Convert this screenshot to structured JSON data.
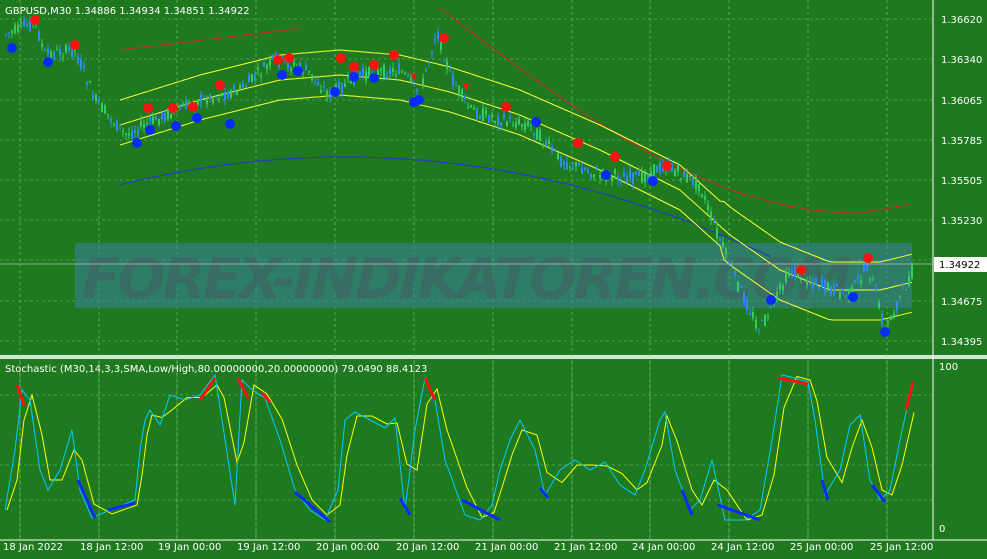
{
  "main_chart": {
    "header": "GBPUSD,M30  1.34886 1.34934 1.34851 1.34922",
    "symbol": "GBPUSD",
    "timeframe": "M30",
    "ohlc": [
      "1.34886",
      "1.34934",
      "1.34851",
      "1.34922"
    ],
    "current_price": "1.34922",
    "price_ticks": [
      "1.36620",
      "1.36340",
      "1.36065",
      "1.35785",
      "1.35505",
      "1.35230",
      "1.34675",
      "1.34395"
    ],
    "watermark": "FOREX-INDIKATOREN.COM"
  },
  "stochastic": {
    "header": "Stochastic (M30,14,3,3,SMA,Low/High,80.00000000,20.00000000) 79.0490 88.4123",
    "levels": [
      "100",
      "0"
    ],
    "main_value": "79.0490",
    "signal_value": "88.4123"
  },
  "time_axis": [
    "18 Jan 2022",
    "18 Jan 12:00",
    "19 Jan 00:00",
    "19 Jan 12:00",
    "20 Jan 00:00",
    "20 Jan 12:00",
    "21 Jan 00:00",
    "21 Jan 12:00",
    "24 Jan 00:00",
    "24 Jan 12:00",
    "25 Jan 00:00",
    "25 Jan 12:00"
  ],
  "colors": {
    "background": "#1f7a1f",
    "grid": "#7fc07f",
    "bull_candle": "#33cc66",
    "bear_candle": "#2e8bff",
    "channel": "#ffff33",
    "upper_curve": "#b8322a",
    "lower_curve": "#1f3fbf",
    "sell_dot": "#ff1111",
    "buy_dot": "#0a2bff",
    "stoch_main": "#00ccff",
    "stoch_signal": "#ffff00"
  },
  "icons": [
    "sell-signal-dot-icon",
    "buy-signal-dot-icon",
    "arrow-down-icon"
  ]
}
